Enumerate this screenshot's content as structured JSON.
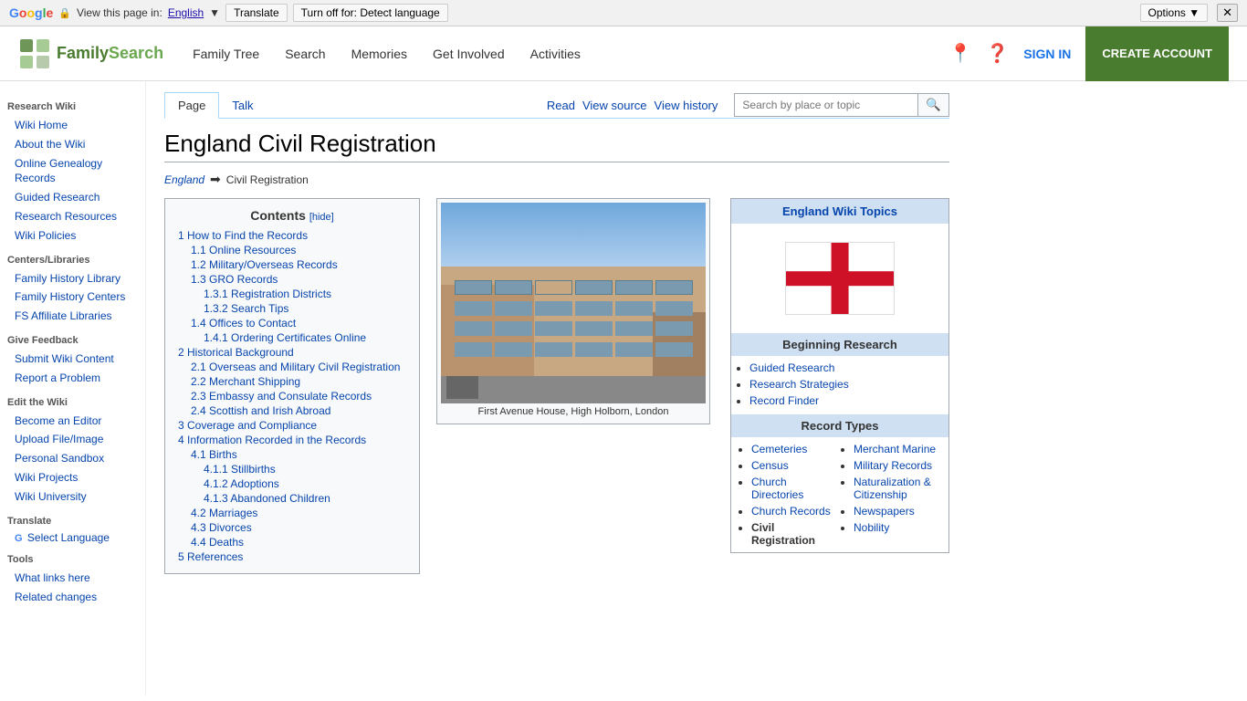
{
  "translate_bar": {
    "google_label": "Google",
    "view_text": "View this page in:",
    "language": "English",
    "translate_btn": "Translate",
    "turnoff_btn": "Turn off for: Detect language",
    "options_btn": "Options ▼",
    "close_btn": "✕"
  },
  "header": {
    "logo_text_family": "Family",
    "logo_text_search": "Search",
    "nav": {
      "family_tree": "Family Tree",
      "search": "Search",
      "memories": "Memories",
      "get_involved": "Get Involved",
      "activities": "Activities"
    },
    "sign_in": "SIGN IN",
    "create_account": "CREATE ACCOUNT"
  },
  "sidebar": {
    "section1_title": "Research Wiki",
    "wiki_home": "Wiki Home",
    "about_wiki": "About the Wiki",
    "online_genealogy": "Online Genealogy Records",
    "guided_research": "Guided Research",
    "research_resources": "Research Resources",
    "wiki_policies": "Wiki Policies",
    "section2_title": "Centers/Libraries",
    "family_history_library": "Family History Library",
    "family_history_centers": "Family History Centers",
    "fs_affiliate": "FS Affiliate Libraries",
    "section3_title": "Give Feedback",
    "submit_wiki": "Submit Wiki Content",
    "report_problem": "Report a Problem",
    "section4_title": "Edit the Wiki",
    "become_editor": "Become an Editor",
    "upload_file": "Upload File/Image",
    "personal_sandbox": "Personal Sandbox",
    "wiki_projects": "Wiki Projects",
    "wiki_university": "Wiki University",
    "section5_title": "Translate",
    "select_language": "Select Language",
    "section6_title": "Tools",
    "what_links": "What links here",
    "related_changes": "Related changes"
  },
  "page_tabs": {
    "page": "Page",
    "talk": "Talk",
    "read": "Read",
    "view_source": "View source",
    "view_history": "View history",
    "search_placeholder": "Search by place or topic"
  },
  "article": {
    "title": "England Civil Registration",
    "breadcrumb_link": "England",
    "breadcrumb_current": "Civil Registration"
  },
  "toc": {
    "title": "Contents",
    "hide_label": "[hide]",
    "items": [
      {
        "num": "1",
        "label": "How to Find the Records",
        "level": 1
      },
      {
        "num": "1.1",
        "label": "Online Resources",
        "level": 2
      },
      {
        "num": "1.2",
        "label": "Military/Overseas Records",
        "level": 2
      },
      {
        "num": "1.3",
        "label": "GRO Records",
        "level": 2
      },
      {
        "num": "1.3.1",
        "label": "Registration Districts",
        "level": 3
      },
      {
        "num": "1.3.2",
        "label": "Search Tips",
        "level": 3
      },
      {
        "num": "1.4",
        "label": "Offices to Contact",
        "level": 2
      },
      {
        "num": "1.4.1",
        "label": "Ordering Certificates Online",
        "level": 3
      },
      {
        "num": "2",
        "label": "Historical Background",
        "level": 1
      },
      {
        "num": "2.1",
        "label": "Overseas and Military Civil Registration",
        "level": 2
      },
      {
        "num": "2.2",
        "label": "Merchant Shipping",
        "level": 2
      },
      {
        "num": "2.3",
        "label": "Embassy and Consulate Records",
        "level": 2
      },
      {
        "num": "2.4",
        "label": "Scottish and Irish Abroad",
        "level": 2
      },
      {
        "num": "3",
        "label": "Coverage and Compliance",
        "level": 1
      },
      {
        "num": "4",
        "label": "Information Recorded in the Records",
        "level": 1
      },
      {
        "num": "4.1",
        "label": "Births",
        "level": 2
      },
      {
        "num": "4.1.1",
        "label": "Stillbirths",
        "level": 3
      },
      {
        "num": "4.1.2",
        "label": "Adoptions",
        "level": 3
      },
      {
        "num": "4.1.3",
        "label": "Abandoned Children",
        "level": 3
      },
      {
        "num": "4.2",
        "label": "Marriages",
        "level": 2
      },
      {
        "num": "4.3",
        "label": "Divorces",
        "level": 2
      },
      {
        "num": "4.4",
        "label": "Deaths",
        "level": 2
      },
      {
        "num": "5",
        "label": "References",
        "level": 1
      }
    ]
  },
  "image": {
    "caption": "First Avenue House, High Holborn, London"
  },
  "right_panel": {
    "topics_header": "England Wiki Topics",
    "beginning_research_header": "Beginning Research",
    "beginning_links": [
      "Guided Research",
      "Research Strategies",
      "Record Finder"
    ],
    "record_types_header": "Record Types",
    "record_col1": [
      "Cemeteries",
      "Census",
      "Church Directories",
      "Church Records",
      "Civil Registration"
    ],
    "record_col2": [
      "Merchant Marine",
      "Military Records",
      "Naturalization & Citizenship",
      "Newspapers",
      "Nobility"
    ]
  }
}
